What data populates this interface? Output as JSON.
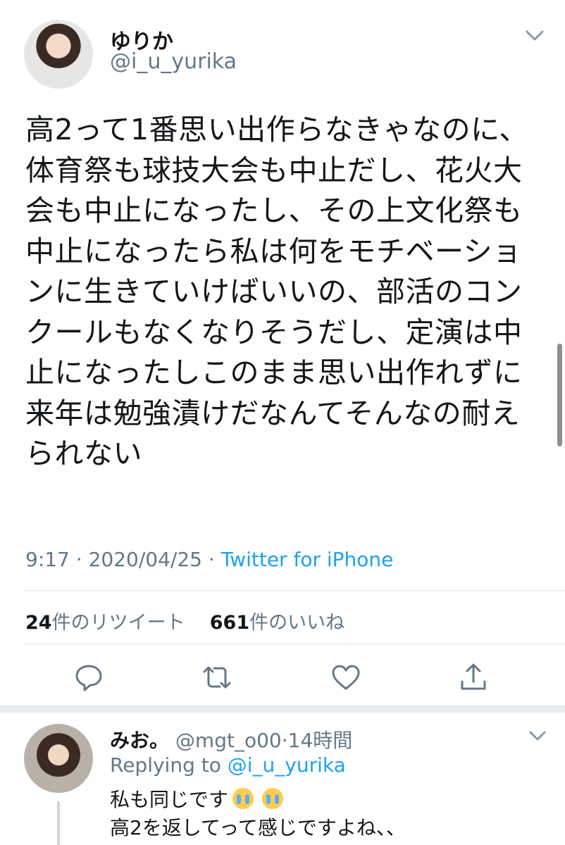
{
  "tweet": {
    "author_name": "ゆりか",
    "author_handle": "@i_u_yurika",
    "text_lines": [
      "高2って1番思い出作らなきゃなのに、",
      "体育祭も球技大会も中止だし、花火大",
      "会も中止になったし、その上文化祭も",
      "中止になったら私は何をモチベーショ",
      "ンに生きていけばいいの、部活のコン",
      "クールもなくなりそうだし、定演は中",
      "止になったしこのまま思い出作れずに",
      "来年は勉強漬けだなんてそんなの耐え",
      "られない"
    ],
    "time": "9:17",
    "sep": "·",
    "date": "2020/04/25",
    "source": "Twitter for iPhone",
    "retweet_count": "24",
    "retweet_label": "件のリツイート",
    "like_count": "661",
    "like_label": "件のいいね"
  },
  "icons": {
    "menu": "chevron-down-icon",
    "reply": "reply-icon",
    "retweet": "retweet-icon",
    "like": "heart-icon",
    "share": "share-icon",
    "emoji": "loudly-crying-face-emoji"
  },
  "reply": {
    "author_name": "みお。",
    "author_handle": "@mgt_o00",
    "time_ago": "14時間",
    "replying_label": "Replying to",
    "replying_handle": "@i_u_yurika",
    "text_line1": "私も同じです",
    "text_line2": "高2を返してって感じですよね、、"
  },
  "colors": {
    "link": "#1da1f2",
    "secondary_text": "#657786",
    "divider": "#e1e8ed"
  }
}
